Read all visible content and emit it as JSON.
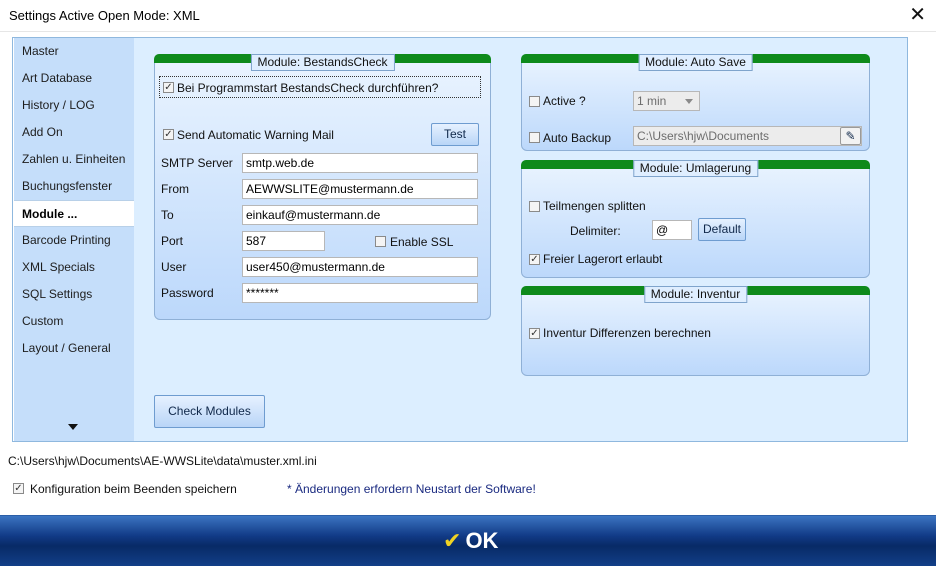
{
  "window": {
    "title": "Settings Active Open Mode: XML",
    "close": "✕"
  },
  "sidebar": {
    "items": [
      {
        "label": "Master"
      },
      {
        "label": "Art Database"
      },
      {
        "label": "History / LOG"
      },
      {
        "label": "Add On"
      },
      {
        "label": "Zahlen u. Einheiten"
      },
      {
        "label": "Buchungsfenster"
      },
      {
        "label": "Module ..."
      },
      {
        "label": "Barcode Printing"
      },
      {
        "label": "XML Specials"
      },
      {
        "label": "SQL Settings"
      },
      {
        "label": "Custom"
      },
      {
        "label": "Layout / General"
      }
    ],
    "active_index": 6
  },
  "bestands": {
    "title": "Module: BestandsCheck",
    "check_start_label": "Bei Programmstart BestandsCheck durchführen?",
    "send_mail_label": "Send Automatic Warning Mail",
    "test_label": "Test",
    "smtp_label": "SMTP Server",
    "smtp_value": "smtp.web.de",
    "from_label": "From",
    "from_value": "AEWWSLITE@mustermann.de",
    "to_label": "To",
    "to_value": "einkauf@mustermann.de",
    "port_label": "Port",
    "port_value": "587",
    "ssl_label": "Enable SSL",
    "user_label": "User",
    "user_value": "user450@mustermann.de",
    "password_label": "Password",
    "password_value": "*******"
  },
  "autosave": {
    "title": "Module: Auto Save",
    "active_label": "Active ?",
    "interval_value": "1 min",
    "backup_label": "Auto Backup",
    "backup_path": "C:\\Users\\hjw\\Documents"
  },
  "umlagerung": {
    "title": "Module: Umlagerung",
    "split_label": "Teilmengen splitten",
    "delimiter_label": "Delimiter:",
    "delimiter_value": "@",
    "default_label": "Default",
    "free_label": "Freier Lagerort erlaubt"
  },
  "inventur": {
    "title": "Module: Inventur",
    "diff_label": "Inventur Differenzen berechnen"
  },
  "check_modules_label": "Check Modules",
  "status_path": "C:\\Users\\hjw\\Documents\\AE-WWSLite\\data\\muster.xml.ini",
  "save_on_exit_label": "Konfiguration beim Beenden speichern",
  "restart_note": "* Änderungen erfordern Neustart der Software!",
  "ok_label": "OK",
  "colors": {
    "accent": "#0e8a1b",
    "ok_bar": "#0c3273",
    "sidebar": "#c5defa"
  }
}
